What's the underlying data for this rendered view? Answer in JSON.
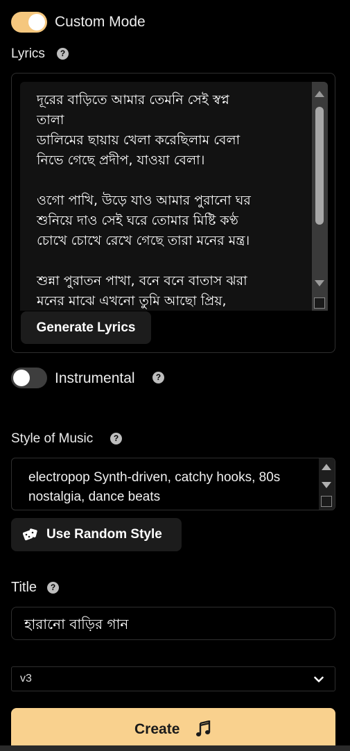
{
  "custom_mode": {
    "label": "Custom Mode",
    "enabled": true
  },
  "lyrics": {
    "label": "Lyrics",
    "text": "দূরের বাড়িতে আমার তেমনি সেই স্বপ্ন\nতালা\nডালিমের ছায়ায় খেলা করেছিলাম বেলা\nনিভে গেছে প্রদীপ, যাওয়া বেলা।\n\nওগো পাখি, উড়ে যাও আমার পুরানো ঘর\nশুনিয়ে দাও সেই ঘরে তোমার মিষ্টি কণ্ঠ\nচোখে চোখে রেখে গেছে তারা মনের মন্ত্র।\n\nশুন্না পুরাতন পাখা, বনে বনে বাতাস ঝরা\nমনের মাঝে এখনো তুমি আছো প্রিয়,",
    "generate_label": "Generate Lyrics"
  },
  "instrumental": {
    "label": "Instrumental",
    "enabled": false
  },
  "style": {
    "label": "Style of Music",
    "value": "electropop Synth-driven, catchy hooks, 80s nostalgia, dance beats",
    "random_label": "Use Random Style"
  },
  "title": {
    "label": "Title",
    "value": "হারানো বাড়ির গান"
  },
  "version": {
    "selected": "v3"
  },
  "create": {
    "label": "Create"
  },
  "colors": {
    "accent": "#f8c87e",
    "create_bg": "#f9d18e"
  }
}
